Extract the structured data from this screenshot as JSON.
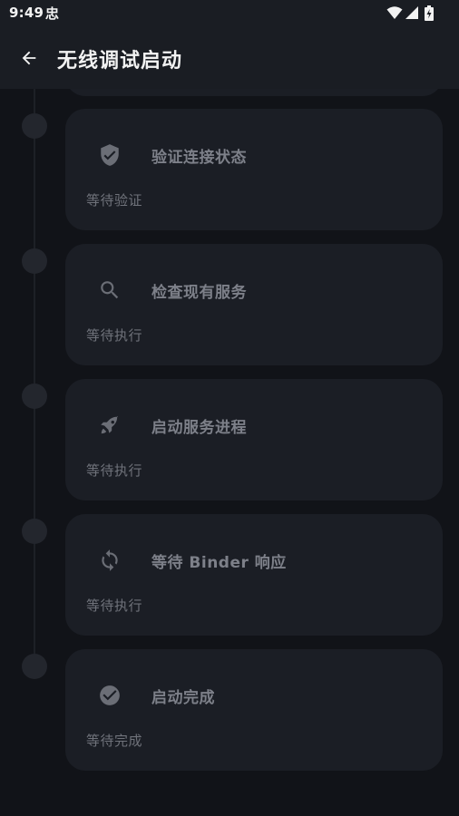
{
  "status_bar": {
    "time": "9:49",
    "notification_glyph": "忠",
    "icons": [
      "wifi-icon",
      "signal-icon",
      "battery-icon"
    ]
  },
  "app_bar": {
    "title": "无线调试启动",
    "back_icon": "arrow-left-icon"
  },
  "steps": [
    {
      "title": "验证连接状态",
      "status": "等待验证",
      "icon": "shield-check-icon"
    },
    {
      "title": "检查现有服务",
      "status": "等待执行",
      "icon": "search-icon"
    },
    {
      "title": "启动服务进程",
      "status": "等待执行",
      "icon": "rocket-icon"
    },
    {
      "title": "等待 Binder 响应",
      "status": "等待执行",
      "icon": "sync-icon"
    },
    {
      "title": "启动完成",
      "status": "等待完成",
      "icon": "check-circle-icon"
    }
  ],
  "colors": {
    "background": "#111318",
    "bar": "#1a1d23",
    "card": "#1b1e25",
    "icon": "#6b6e76",
    "title_text": "#7d8089",
    "sub_text": "#6f727a",
    "timeline_dot": "#23262d"
  }
}
